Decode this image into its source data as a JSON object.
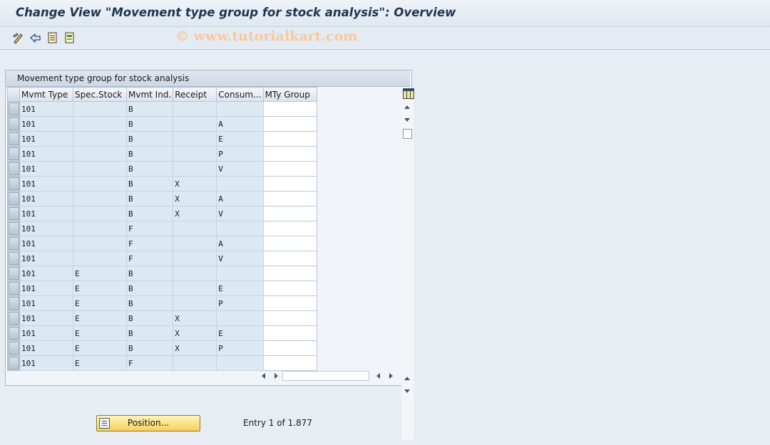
{
  "window": {
    "title": "Change View \"Movement type group for stock analysis\": Overview"
  },
  "toolbar": {
    "icons": [
      "change-display-icon",
      "undo-icon",
      "select-all-icon",
      "details-icon"
    ],
    "watermark": "© www.tutorialkart.com"
  },
  "table": {
    "caption": "Movement type group for stock analysis",
    "columns": [
      "Mvmt Type",
      "Spec.Stock",
      "Mvmt Ind.",
      "Receipt",
      "Consum...",
      "MTy Group"
    ],
    "rows": [
      [
        "101",
        "",
        "B",
        "",
        "",
        ""
      ],
      [
        "101",
        "",
        "B",
        "",
        "A",
        ""
      ],
      [
        "101",
        "",
        "B",
        "",
        "E",
        ""
      ],
      [
        "101",
        "",
        "B",
        "",
        "P",
        ""
      ],
      [
        "101",
        "",
        "B",
        "",
        "V",
        ""
      ],
      [
        "101",
        "",
        "B",
        "X",
        "",
        ""
      ],
      [
        "101",
        "",
        "B",
        "X",
        "A",
        ""
      ],
      [
        "101",
        "",
        "B",
        "X",
        "V",
        ""
      ],
      [
        "101",
        "",
        "F",
        "",
        "",
        ""
      ],
      [
        "101",
        "",
        "F",
        "",
        "A",
        ""
      ],
      [
        "101",
        "",
        "F",
        "",
        "V",
        ""
      ],
      [
        "101",
        "E",
        "B",
        "",
        "",
        ""
      ],
      [
        "101",
        "E",
        "B",
        "",
        "E",
        ""
      ],
      [
        "101",
        "E",
        "B",
        "",
        "P",
        ""
      ],
      [
        "101",
        "E",
        "B",
        "X",
        "",
        ""
      ],
      [
        "101",
        "E",
        "B",
        "X",
        "E",
        ""
      ],
      [
        "101",
        "E",
        "B",
        "X",
        "P",
        ""
      ],
      [
        "101",
        "E",
        "F",
        "",
        "",
        ""
      ]
    ]
  },
  "footer": {
    "position_button": "Position...",
    "entry_text": "Entry 1 of 1.877"
  },
  "colors": {
    "title": "#1f3550",
    "button": "#f6d25e",
    "cell": "#dde9f2",
    "input_cell": "#ffffff"
  }
}
